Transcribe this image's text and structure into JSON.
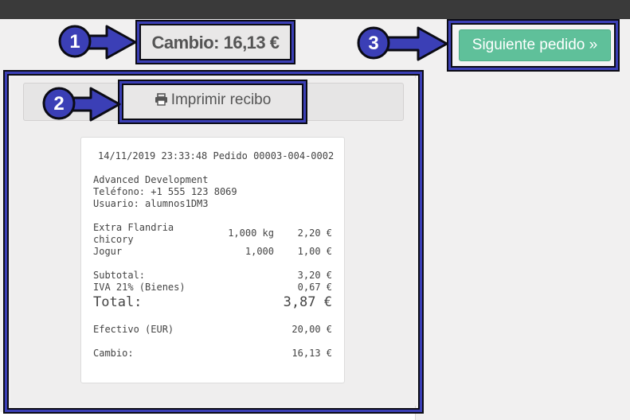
{
  "header": {
    "cambio": "Cambio: 16,13 €"
  },
  "actions": {
    "next_order": "Siguiente pedido »",
    "print_receipt": "Imprimir recibo"
  },
  "callouts": {
    "one": "1",
    "two": "2",
    "three": "3"
  },
  "receipt": {
    "header_line": "14/11/2019 23:33:48 Pedido 00003-004-0002",
    "company": "Advanced Development",
    "phone": "Teléfono: +1 555 123 8069",
    "user": "Usuario: alumnos1DM3",
    "lines": [
      {
        "name_1": "Extra Flandria",
        "name_2": "chicory",
        "qty": "1,000 kg",
        "price": "2,20 €"
      },
      {
        "name_1": "Jogur",
        "name_2": "",
        "qty": "1,000",
        "price": "1,00 €"
      }
    ],
    "subtotal_label": "Subtotal:",
    "subtotal_value": "3,20 €",
    "tax_label": "IVA 21% (Bienes)",
    "tax_value": "0,67 €",
    "total_label": "Total:",
    "total_value": "3,87 €",
    "payment_label": "Efectivo (EUR)",
    "payment_value": "20,00 €",
    "change_label": "Cambio:",
    "change_value": "16,13 €"
  },
  "colors": {
    "callout_blue": "#3b3fb6",
    "next_button_green": "#5fc09a",
    "topbar": "#3a3a3a"
  },
  "icons": {
    "print": "print-icon",
    "callout_arrow": "arrow-right-icon"
  }
}
